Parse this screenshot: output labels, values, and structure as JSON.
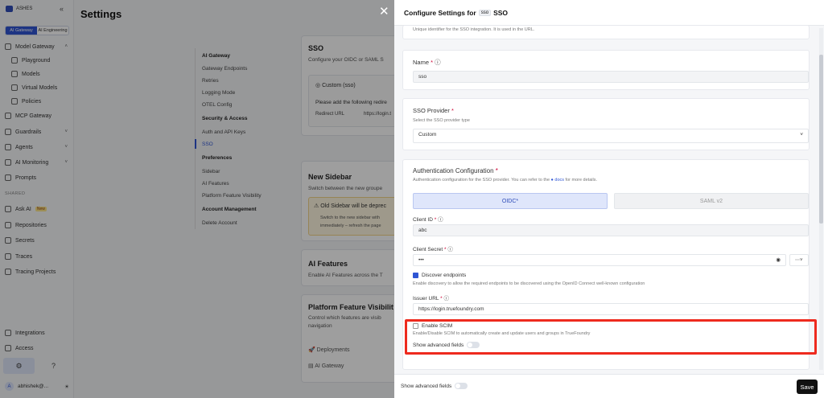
{
  "app": {
    "logo_text": "ASHES",
    "tabs": [
      "AI Gateway",
      "AI Engineering"
    ]
  },
  "sidebar": {
    "items": [
      {
        "label": "Model Gateway",
        "icon": "gateway-icon"
      },
      {
        "label": "Playground",
        "icon": "play-icon"
      },
      {
        "label": "Models",
        "icon": "grid-icon"
      },
      {
        "label": "Virtual Models",
        "icon": "layers-icon"
      },
      {
        "label": "Policies",
        "icon": "doc-icon"
      },
      {
        "label": "MCP Gateway",
        "icon": "mcp-icon"
      },
      {
        "label": "Guardrails",
        "icon": "shield-icon"
      },
      {
        "label": "Agents",
        "icon": "agent-icon"
      },
      {
        "label": "AI Monitoring",
        "icon": "chart-icon"
      },
      {
        "label": "Prompts",
        "icon": "prompt-icon"
      }
    ],
    "shared_label": "SHARED",
    "shared_items": [
      {
        "label": "Ask AI",
        "badge": "New"
      },
      {
        "label": "Repositories"
      },
      {
        "label": "Secrets"
      },
      {
        "label": "Traces"
      },
      {
        "label": "Tracing Projects"
      }
    ],
    "bottom_items": [
      {
        "label": "Integrations"
      },
      {
        "label": "Access"
      }
    ],
    "user": "abhishek@..."
  },
  "page": {
    "title": "Settings",
    "settings_nav": {
      "ai_gateway": "AI Gateway",
      "gateway_endpoints": "Gateway Endpoints",
      "retries": "Retries",
      "logging_mode": "Logging Mode",
      "otel_config": "OTEL Config",
      "security_access": "Security & Access",
      "auth_api_keys": "Auth and API Keys",
      "sso": "SSO",
      "preferences": "Preferences",
      "sidebar": "Sidebar",
      "ai_features": "AI Features",
      "platform_feature_visibility": "Platform Feature Visibility",
      "account_management": "Account Management",
      "delete_account": "Delete Account"
    },
    "sso_card": {
      "title": "SSO",
      "desc": "Configure your OIDC or SAML S",
      "item": "Custom (sso)",
      "notice": "Please add the following redire",
      "redirect_label": "Redirect URL",
      "redirect_value": "https://login.t"
    },
    "new_sidebar_card": {
      "title": "New Sidebar",
      "desc": "Switch between the new groupe",
      "warn_title": "Old Sidebar will be deprec",
      "warn_line1": "Switch to the new sidebar with",
      "warn_line2": "immediately – refresh the page"
    },
    "ai_features_card": {
      "title": "AI Features",
      "desc": "Enable AI Features across the T"
    },
    "platform_card": {
      "title": "Platform Feature Visibilit",
      "desc": "Control which features are visib",
      "desc2": "navigation",
      "items": [
        "Deployments",
        "AI Gateway"
      ]
    }
  },
  "panel": {
    "title_prefix": "Configure Settings for",
    "title_chip": "sso",
    "title_suffix": "SSO",
    "top_hint": "Unique identifier for the SSO integration. It is used in the URL.",
    "name": {
      "label": "Name",
      "value": "sso"
    },
    "provider": {
      "label": "SSO Provider",
      "hint": "Select the SSO provider type",
      "value": "Custom"
    },
    "auth": {
      "label": "Authentication Configuration",
      "hint": "Authentication configuration for the SSO provider. You can refer to the",
      "docs_link": "docs",
      "hint_suffix": "for more details.",
      "tabs": [
        "OIDC",
        "SAML v2"
      ],
      "client_id_label": "Client ID",
      "client_id_value": "abc",
      "client_secret_label": "Client Secret",
      "client_secret_value": "•••",
      "discover_label": "Discover endpoints",
      "discover_hint": "Enable discovery to allow the required endpoints to be discovered using the OpenID Connect well-known configuration",
      "issuer_label": "Issuer URL",
      "issuer_value": "https://login.truefoundry.com",
      "scim_label": "Enable SCIM",
      "scim_hint": "Enable/Disable SCIM to automatically create and update users and groups in TrueFoundry",
      "advanced_label": "Show advanced fields"
    },
    "footer": {
      "advanced_label": "Show advanced fields",
      "save_label": "Save"
    }
  },
  "colors": {
    "accent": "#2f55d4",
    "highlight": "#ee2a1e",
    "save_bg": "#111111"
  }
}
